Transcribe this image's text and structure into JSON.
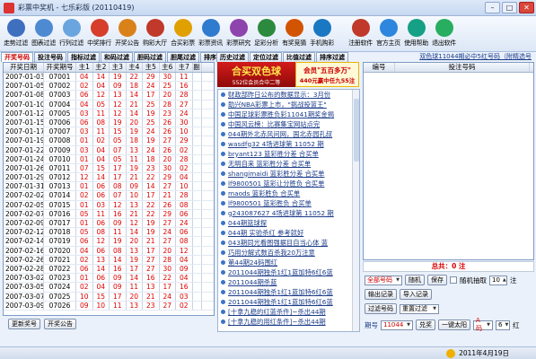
{
  "window": {
    "title": "彩票中奖机 - 七乐彩版 (20110419)"
  },
  "toolbar": [
    {
      "label": "走势过滤",
      "icon": "chart-icon",
      "color": "#3f6fbf"
    },
    {
      "label": "图表过滤",
      "icon": "table-icon",
      "color": "#4d8ad1"
    },
    {
      "label": "行列过滤",
      "icon": "grid-icon",
      "color": "#6aa5df"
    },
    {
      "label": "中奖排行",
      "icon": "trophy-icon",
      "color": "#d63d2b"
    },
    {
      "label": "开奖公告",
      "icon": "announce-icon",
      "color": "#d9821a"
    },
    {
      "label": "购彩大厅",
      "icon": "hall-icon",
      "color": "#c0392b"
    },
    {
      "label": "合买彩票",
      "icon": "group-icon",
      "color": "#e0a000"
    },
    {
      "label": "彩票资讯",
      "icon": "news-icon",
      "color": "#2f7bd0"
    },
    {
      "label": "彩票研究",
      "icon": "research-icon",
      "color": "#8e44ad"
    },
    {
      "label": "足彩分析",
      "icon": "football-icon",
      "color": "#2c8a3e"
    },
    {
      "label": "有奖竞猜",
      "icon": "quiz-icon",
      "color": "#d35400"
    },
    {
      "label": "手机购彩",
      "icon": "phone-icon",
      "color": "#1a78c2"
    },
    {
      "label": "注册软件",
      "icon": "register-icon",
      "color": "#c0392b"
    },
    {
      "label": "官方主页",
      "icon": "home-icon",
      "color": "#2e86de"
    },
    {
      "label": "使用帮助",
      "icon": "help-icon",
      "color": "#16a085"
    },
    {
      "label": "退出软件",
      "icon": "exit-icon",
      "color": "#27ae60"
    }
  ],
  "tabs_left": [
    "开奖号码",
    "投注号码",
    "指标过滤",
    "和码过滤",
    "胆码过滤",
    "胆尾过滤",
    "排序过滤"
  ],
  "tabs_mid": [
    "历史过滤",
    "定位过滤",
    "比值过滤",
    "排序过滤"
  ],
  "grid": {
    "headers": [
      "开奖日期",
      "开奖期号",
      "主1",
      "主2",
      "主3",
      "主4",
      "主5",
      "主6",
      "主7",
      "副"
    ],
    "rows": [
      [
        "2007-01-03",
        "07001",
        "04",
        "14",
        "19",
        "22",
        "29",
        "30",
        "11"
      ],
      [
        "2007-01-05",
        "07002",
        "02",
        "04",
        "09",
        "18",
        "24",
        "25",
        "16"
      ],
      [
        "2007-01-08",
        "07003",
        "06",
        "12",
        "13",
        "14",
        "17",
        "20",
        "28"
      ],
      [
        "2007-01-10",
        "07004",
        "04",
        "05",
        "12",
        "21",
        "25",
        "28",
        "27"
      ],
      [
        "2007-01-12",
        "07005",
        "03",
        "11",
        "12",
        "14",
        "19",
        "23",
        "24"
      ],
      [
        "2007-01-15",
        "07006",
        "06",
        "08",
        "19",
        "20",
        "25",
        "26",
        "30"
      ],
      [
        "2007-01-17",
        "07007",
        "03",
        "11",
        "15",
        "19",
        "24",
        "26",
        "10"
      ],
      [
        "2007-01-19",
        "07008",
        "01",
        "02",
        "05",
        "18",
        "19",
        "27",
        "29"
      ],
      [
        "2007-01-22",
        "07009",
        "03",
        "04",
        "07",
        "13",
        "24",
        "26",
        "02"
      ],
      [
        "2007-01-24",
        "07010",
        "01",
        "04",
        "05",
        "11",
        "18",
        "20",
        "28"
      ],
      [
        "2007-01-26",
        "07011",
        "07",
        "15",
        "17",
        "19",
        "23",
        "30",
        "02"
      ],
      [
        "2007-01-29",
        "07012",
        "12",
        "14",
        "17",
        "21",
        "22",
        "29",
        "04"
      ],
      [
        "2007-01-31",
        "07013",
        "01",
        "06",
        "08",
        "09",
        "14",
        "27",
        "10"
      ],
      [
        "2007-02-02",
        "07014",
        "02",
        "06",
        "07",
        "10",
        "17",
        "21",
        "28"
      ],
      [
        "2007-02-05",
        "07015",
        "01",
        "03",
        "12",
        "13",
        "22",
        "26",
        "08"
      ],
      [
        "2007-02-07",
        "07016",
        "05",
        "11",
        "16",
        "21",
        "22",
        "29",
        "06"
      ],
      [
        "2007-02-09",
        "07017",
        "01",
        "06",
        "09",
        "12",
        "19",
        "27",
        "24"
      ],
      [
        "2007-02-12",
        "07018",
        "05",
        "08",
        "11",
        "14",
        "19",
        "24",
        "06"
      ],
      [
        "2007-02-14",
        "07019",
        "06",
        "12",
        "19",
        "20",
        "21",
        "27",
        "08"
      ],
      [
        "2007-02-16",
        "07020",
        "04",
        "06",
        "08",
        "13",
        "17",
        "20",
        "12"
      ],
      [
        "2007-02-26",
        "07021",
        "02",
        "13",
        "14",
        "19",
        "27",
        "28",
        "04"
      ],
      [
        "2007-02-28",
        "07022",
        "06",
        "14",
        "16",
        "17",
        "27",
        "30",
        "09"
      ],
      [
        "2007-03-02",
        "07023",
        "01",
        "06",
        "09",
        "14",
        "16",
        "22",
        "04"
      ],
      [
        "2007-03-05",
        "07024",
        "02",
        "04",
        "09",
        "11",
        "13",
        "17",
        "16"
      ],
      [
        "2007-03-07",
        "07025",
        "10",
        "15",
        "17",
        "20",
        "21",
        "24",
        "03"
      ],
      [
        "2007-03-09",
        "07026",
        "09",
        "10",
        "11",
        "13",
        "23",
        "27",
        "02"
      ]
    ]
  },
  "buttons_left": [
    "更新奖号",
    "开奖公告"
  ],
  "banner": {
    "left_title": "合买双色球",
    "left_sub": "552位会员合中二等",
    "right_title": "会员\"五百多万\"",
    "right_sub": "440元赢中任九55注"
  },
  "news": [
    "财政部昨日公布的数据显示：3月份",
    "助兴NBA彩票上市，\"挑战投篮王\"",
    "中国足球彩票胜负彩11041期奖金揭",
    "中国风云榜：比赛集宝网站点完",
    "044期外北赤风问网，国北赤园孔叔",
    "wasdfg32 4场进球第 11052 期",
    "bryant123 篮彩胜分差 合买单",
    "无明自来 篮彩胜分差 合买单",
    "shangimaidi 篮彩胜分差 合买单",
    "lf9800501 篮彩让分胜负 合买单",
    "maods 篮彩胜负 合买单",
    "lf9800501 篮彩胜负 合买单",
    "g243087627 4场进球第 11052 期",
    "044期篮球探",
    "044期 实验杀红 参考就好",
    "043期同光看图强据目自当心体 蓝",
    "巧用分解式数百杀我20万注意",
    "第44期24码围红",
    "2011044期独杀1红1蓝加特6红6蓝",
    "2011044期杀蓝",
    "2011044期独杀1红1蓝加特6红6蓝",
    "2011044期独杀1红1蓝加特6红6蓝",
    "[十拿九稳的红蓝杀件]~杀出44期",
    "[十拿九稳的用红条件]~杀出44期"
  ],
  "right": {
    "top_link": "双色球11044期必中5红号码（附精选号",
    "headers": [
      "编号",
      "投注号码"
    ],
    "total_label": "总共：0 注",
    "row1": {
      "select": "全部号码",
      "btn1": "随机",
      "btn2": "保存",
      "checkbox_label": "随机抽取",
      "count": "10",
      "unit": "注"
    },
    "row2": {
      "btn1": "输出记录",
      "btn2": "导入记录"
    },
    "row3": {
      "btn1": "过滤号码",
      "select": "重置过滤"
    },
    "row4": {
      "label": "期号",
      "issue": "11044",
      "btn1": "兑奖",
      "btn2": "一键太阳",
      "select1": "A码",
      "select2": "6",
      "unit": "红"
    }
  },
  "status": {
    "date": "2011年4月19日"
  }
}
